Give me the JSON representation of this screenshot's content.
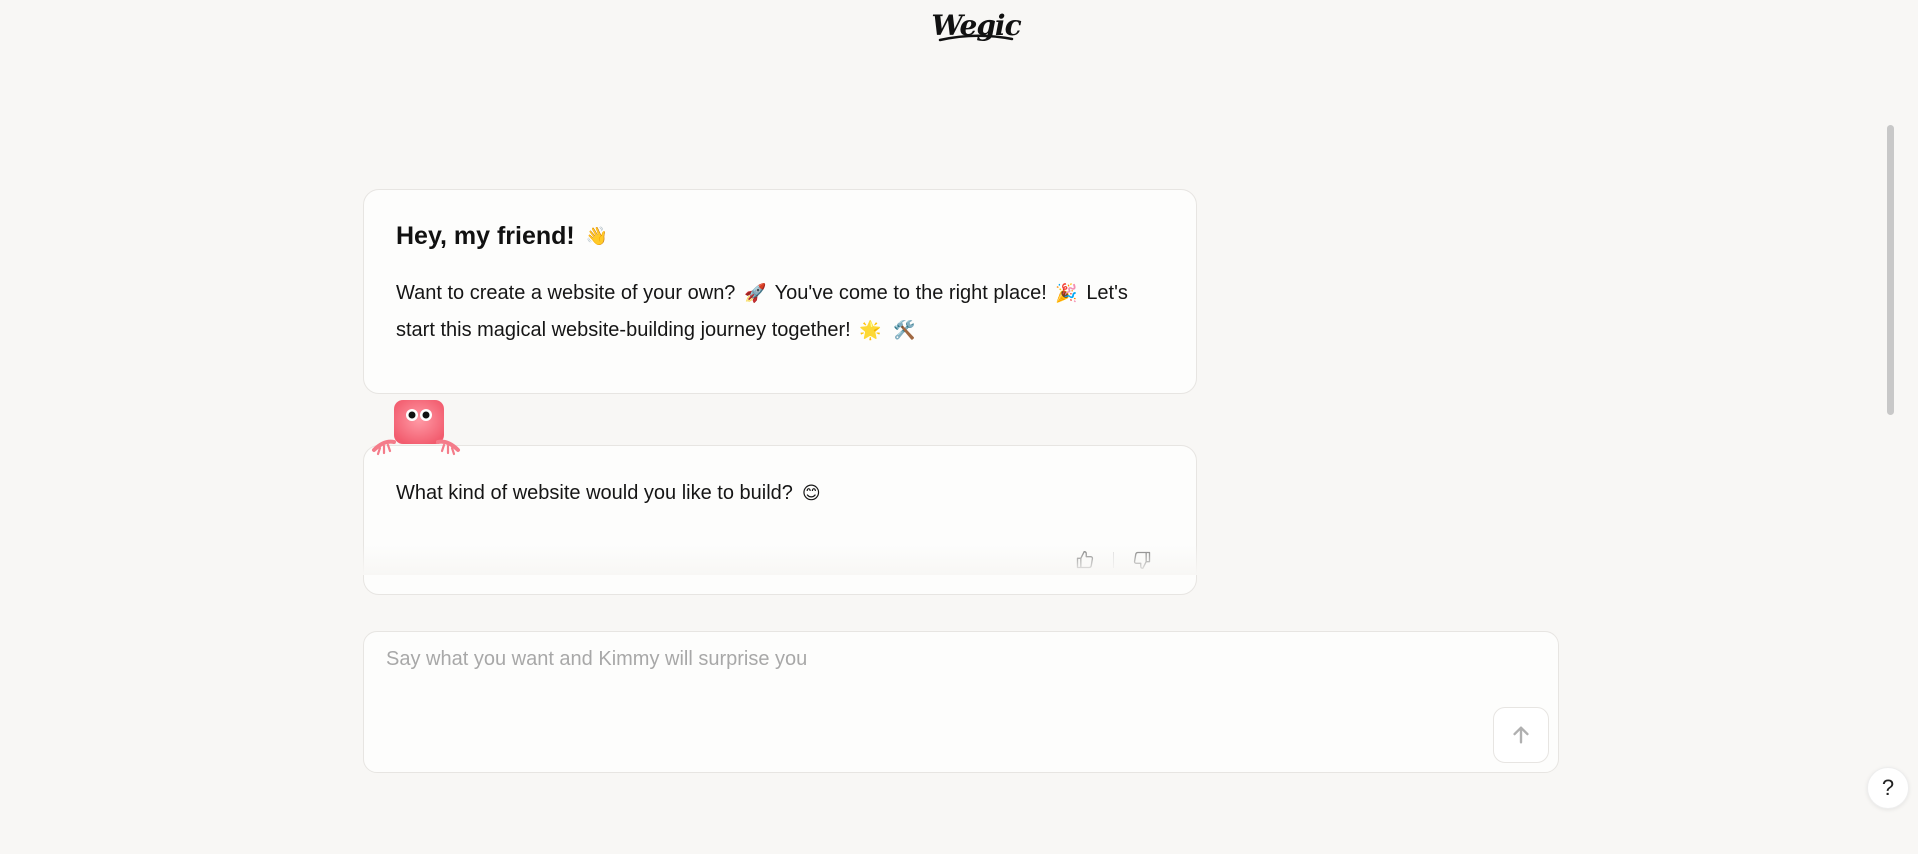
{
  "brand": {
    "logo_text": "Wegic"
  },
  "greeting": {
    "title": "Hey, my friend!",
    "title_emoji": "👋",
    "text_part1": "Want to create a website of your own?",
    "emoji1": "🚀",
    "text_part2": "You've come to the right place!",
    "emoji2": "🎉",
    "text_part3": "Let's start this magical website-building journey together!",
    "emoji3": "🌟",
    "emoji4": "🛠️"
  },
  "question": {
    "text": "What kind of website would you like to build?",
    "emoji": "😊"
  },
  "feedback": {
    "like_icon": "thumbs-up-icon",
    "dislike_icon": "thumbs-down-icon"
  },
  "composer": {
    "placeholder": "Say what you want and Kimmy will surprise you",
    "value": "",
    "send_icon": "arrow-up-icon"
  },
  "help": {
    "label": "?"
  },
  "colors": {
    "background": "#f8f7f5",
    "card": "#fdfdfc",
    "border": "#e7e5e2",
    "mascot": "#f46a7a",
    "placeholder": "#a8a8a8"
  }
}
